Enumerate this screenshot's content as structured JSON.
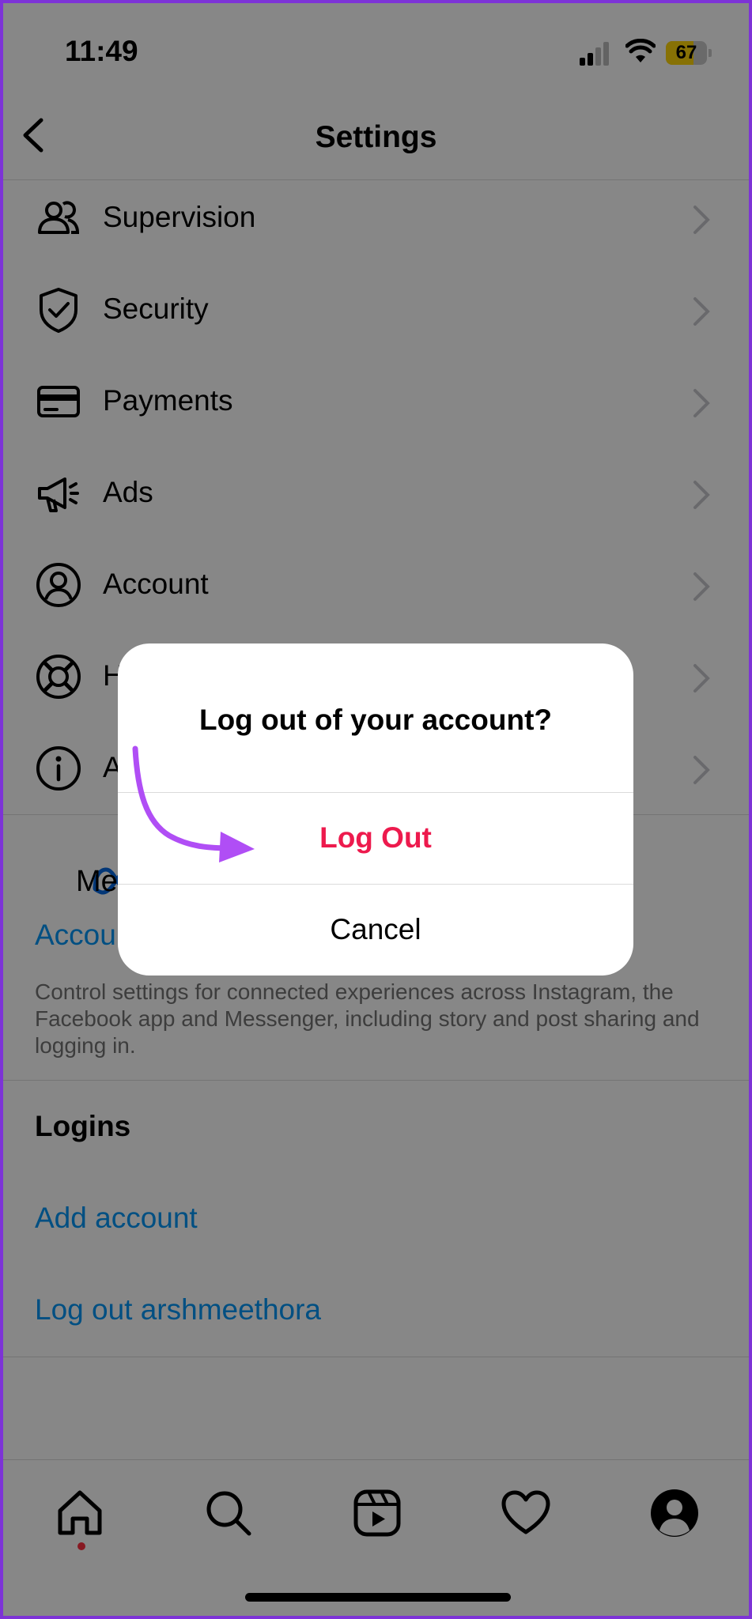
{
  "status_bar": {
    "time": "11:49",
    "battery": "67",
    "battery_level": 0.67
  },
  "header": {
    "title": "Settings"
  },
  "settings_items": [
    {
      "label": "Supervision",
      "icon": "supervision-icon"
    },
    {
      "label": "Security",
      "icon": "shield-icon"
    },
    {
      "label": "Payments",
      "icon": "card-icon"
    },
    {
      "label": "Ads",
      "icon": "megaphone-icon"
    },
    {
      "label": "Account",
      "icon": "account-icon"
    },
    {
      "label": "H",
      "icon": "lifebuoy-icon"
    },
    {
      "label": "A",
      "icon": "info-icon"
    }
  ],
  "meta_section": {
    "logo_text": "Me",
    "link": "Accou",
    "description": "Control settings for connected experiences across Instagram, the Facebook app and Messenger, including story and post sharing and logging in."
  },
  "logins_section": {
    "heading": "Logins",
    "add_account": "Add account",
    "log_out_user": "Log out arshmeethora"
  },
  "dialog": {
    "title": "Log out of your account?",
    "confirm_label": "Log Out",
    "cancel_label": "Cancel"
  },
  "tab_bar": [
    "home-icon",
    "search-icon",
    "reels-icon",
    "heart-icon",
    "profile-icon"
  ],
  "colors": {
    "link": "#0095f6",
    "logout": "#ed1a4d",
    "annotation_arrow": "#b04ef5",
    "battery_fill": "#ffd60a"
  }
}
